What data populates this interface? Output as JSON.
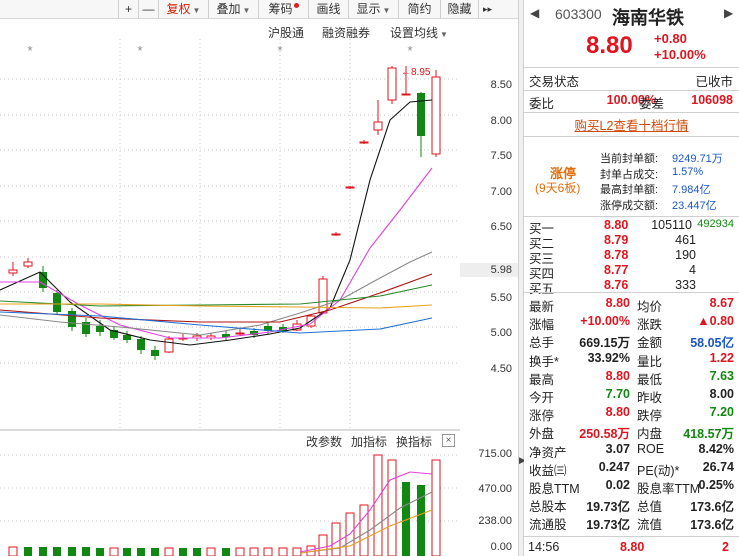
{
  "toolbar": {
    "plus": "+",
    "minus": "—",
    "fuquan": "复权",
    "diejia": "叠加",
    "chouma": "筹码",
    "huaxian": "画线",
    "xianshi": "显示",
    "jianyue": "简约",
    "yincang": "隐藏",
    "more": "▸▸"
  },
  "chart_menu": {
    "hgt": "沪股通",
    "rzrq": "融资融券",
    "ma_setting": "设置均线"
  },
  "y_axis": [
    "8.50",
    "8.00",
    "7.50",
    "7.00",
    "6.50",
    "5.98",
    "5.50",
    "5.00",
    "4.50"
  ],
  "high_marker": "8.95",
  "indicator_bar": {
    "modify": "改参数",
    "add": "加指标",
    "switch": "换指标",
    "close": "×"
  },
  "volume_axis": [
    "715.00",
    "470.00",
    "238.00",
    "0.00"
  ],
  "quote": {
    "code": "603300",
    "name": "海南华铁",
    "price": "8.80",
    "change": "+0.80",
    "pct": "+10.00%",
    "trade_status_label": "交易状态",
    "trade_status": "已收市",
    "weibi_label": "委比",
    "weibi": "100.00%",
    "weicha_label": "委差",
    "weicha": "106098",
    "l2_link": "购买L2查看十档行情",
    "limit_title": "涨停",
    "limit_sub": "(9天6板)",
    "limit_rows": [
      {
        "label": "当前封单额:",
        "value": "9249.71万"
      },
      {
        "label": "封单占成交:",
        "value": "1.57%"
      },
      {
        "label": "最高封单额:",
        "value": "7.984亿"
      },
      {
        "label": "涨停成交额:",
        "value": "23.447亿"
      }
    ],
    "bids": [
      {
        "label": "买一",
        "price": "8.80",
        "vol": "105110",
        "extra": "492934"
      },
      {
        "label": "买二",
        "price": "8.79",
        "vol": "461"
      },
      {
        "label": "买三",
        "price": "8.78",
        "vol": "190"
      },
      {
        "label": "买四",
        "price": "8.77",
        "vol": "4"
      },
      {
        "label": "买五",
        "price": "8.76",
        "vol": "333"
      }
    ],
    "stats": [
      {
        "l1": "最新",
        "v1": "8.80",
        "c1": "red",
        "l2": "均价",
        "v2": "8.67",
        "c2": "red"
      },
      {
        "l1": "涨幅",
        "v1": "+10.00%",
        "c1": "red",
        "l2": "涨跌",
        "v2": "▲0.80",
        "c2": "red"
      },
      {
        "l1": "总手",
        "v1": "669.15万",
        "c1": "dark",
        "l2": "金额",
        "v2": "58.05亿",
        "c2": "blue"
      },
      {
        "l1": "换手*",
        "v1": "33.92%",
        "c1": "dark",
        "l2": "量比",
        "v2": "1.22",
        "c2": "red"
      },
      {
        "l1": "最高",
        "v1": "8.80",
        "c1": "red",
        "l2": "最低",
        "v2": "7.63",
        "c2": "green"
      },
      {
        "l1": "今开",
        "v1": "7.70",
        "c1": "green",
        "l2": "昨收",
        "v2": "8.00",
        "c2": "dark"
      },
      {
        "l1": "涨停",
        "v1": "8.80",
        "c1": "red",
        "l2": "跌停",
        "v2": "7.20",
        "c2": "green"
      },
      {
        "l1": "外盘",
        "v1": "250.58万",
        "c1": "red",
        "l2": "内盘",
        "v2": "418.57万",
        "c2": "green"
      },
      {
        "l1": "净资产",
        "v1": "3.07",
        "c1": "dark",
        "l2": "ROE",
        "v2": "8.42%",
        "c2": "dark"
      },
      {
        "l1": "收益㈢",
        "v1": "0.247",
        "c1": "dark",
        "l2": "PE(动)*",
        "v2": "26.74",
        "c2": "dark"
      },
      {
        "l1": "股息TTM",
        "v1": "0.02",
        "c1": "dark",
        "l2": "股息率TTM",
        "v2": "0.25%",
        "c2": "dark"
      },
      {
        "l1": "总股本",
        "v1": "19.73亿",
        "c1": "dark",
        "l2": "总值",
        "v2": "173.6亿",
        "c2": "dark"
      },
      {
        "l1": "流通股",
        "v1": "19.73亿",
        "c1": "dark",
        "l2": "流值",
        "v2": "173.6亿",
        "c2": "dark"
      }
    ],
    "tick": {
      "time": "14:56",
      "price": "8.80",
      "vol": "2"
    }
  },
  "colors": {
    "up": "#e0141e",
    "down": "#118811",
    "ma5": "#111111",
    "ma10": "#e040e0",
    "ma20": "#888888",
    "ma30": "#b01010",
    "ma60": "#2a8a2a",
    "ma120": "#e8a020",
    "ma250": "#2070d0"
  }
}
